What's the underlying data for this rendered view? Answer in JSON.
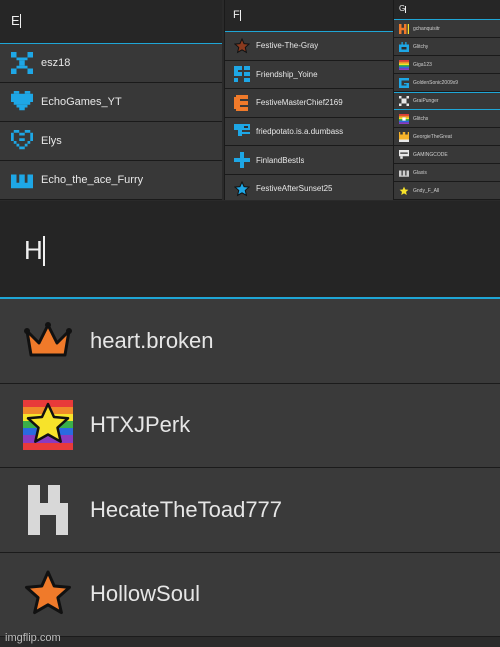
{
  "panels": {
    "e": {
      "query": "E",
      "results": [
        {
          "label": "esz18",
          "icon": "pixel-cross-icon"
        },
        {
          "label": "EchoGames_YT",
          "icon": "pixel-heart-icon"
        },
        {
          "label": "Elys",
          "icon": "pixel-heart-outline-icon"
        },
        {
          "label": "Echo_the_ace_Furry",
          "icon": "pixel-crown-icon"
        }
      ]
    },
    "f": {
      "query": "F",
      "results": [
        {
          "label": "Festive-The-Gray",
          "icon": "star-icon"
        },
        {
          "label": "Friendship_Yoine",
          "icon": "pixel-glyph-icon"
        },
        {
          "label": "FestiveMasterChief2169",
          "icon": "pacman-icon"
        },
        {
          "label": "friedpotato.is.a.dumbass",
          "icon": "pixel-bracket-icon"
        },
        {
          "label": "FinlandBestIs",
          "icon": "cross-icon"
        },
        {
          "label": "FestiveAfterSunset25",
          "icon": "star-icon"
        }
      ]
    },
    "g": {
      "query": "G",
      "results": [
        {
          "label": "gchanquisitr",
          "icon": "pixel-h-icon"
        },
        {
          "label": "Glitchy",
          "icon": "pixel-box-icon"
        },
        {
          "label": "Giga123",
          "icon": "rainbow-flag-icon"
        },
        {
          "label": "GoldenSonic2009x9",
          "icon": "pixel-g-icon"
        },
        {
          "label": "GraiPunger",
          "icon": "pixel-cross-icon"
        },
        {
          "label": "Glitchs",
          "icon": "rainbow-flag-icon"
        },
        {
          "label": "GeorgieTheGreat",
          "icon": "crown-icon"
        },
        {
          "label": "GAMINGCODE",
          "icon": "chat-icon"
        },
        {
          "label": "Glaxis",
          "icon": "tag-icon"
        },
        {
          "label": "Gndy_F_All",
          "icon": "star-icon"
        }
      ]
    },
    "h": {
      "query": "H",
      "results": [
        {
          "label": "heart.broken",
          "icon": "crown-icon"
        },
        {
          "label": "HTXJPerk",
          "icon": "rainbow-star-icon"
        },
        {
          "label": "HecateTheToad777",
          "icon": "pixel-h-icon"
        },
        {
          "label": "HollowSoul",
          "icon": "star-icon"
        }
      ]
    }
  },
  "watermark": "imgflip.com",
  "colors": {
    "accent": "#1fa6d6",
    "orange": "#f07a2a",
    "yellow": "#f7e32a",
    "cyan": "#1ea7e6"
  }
}
